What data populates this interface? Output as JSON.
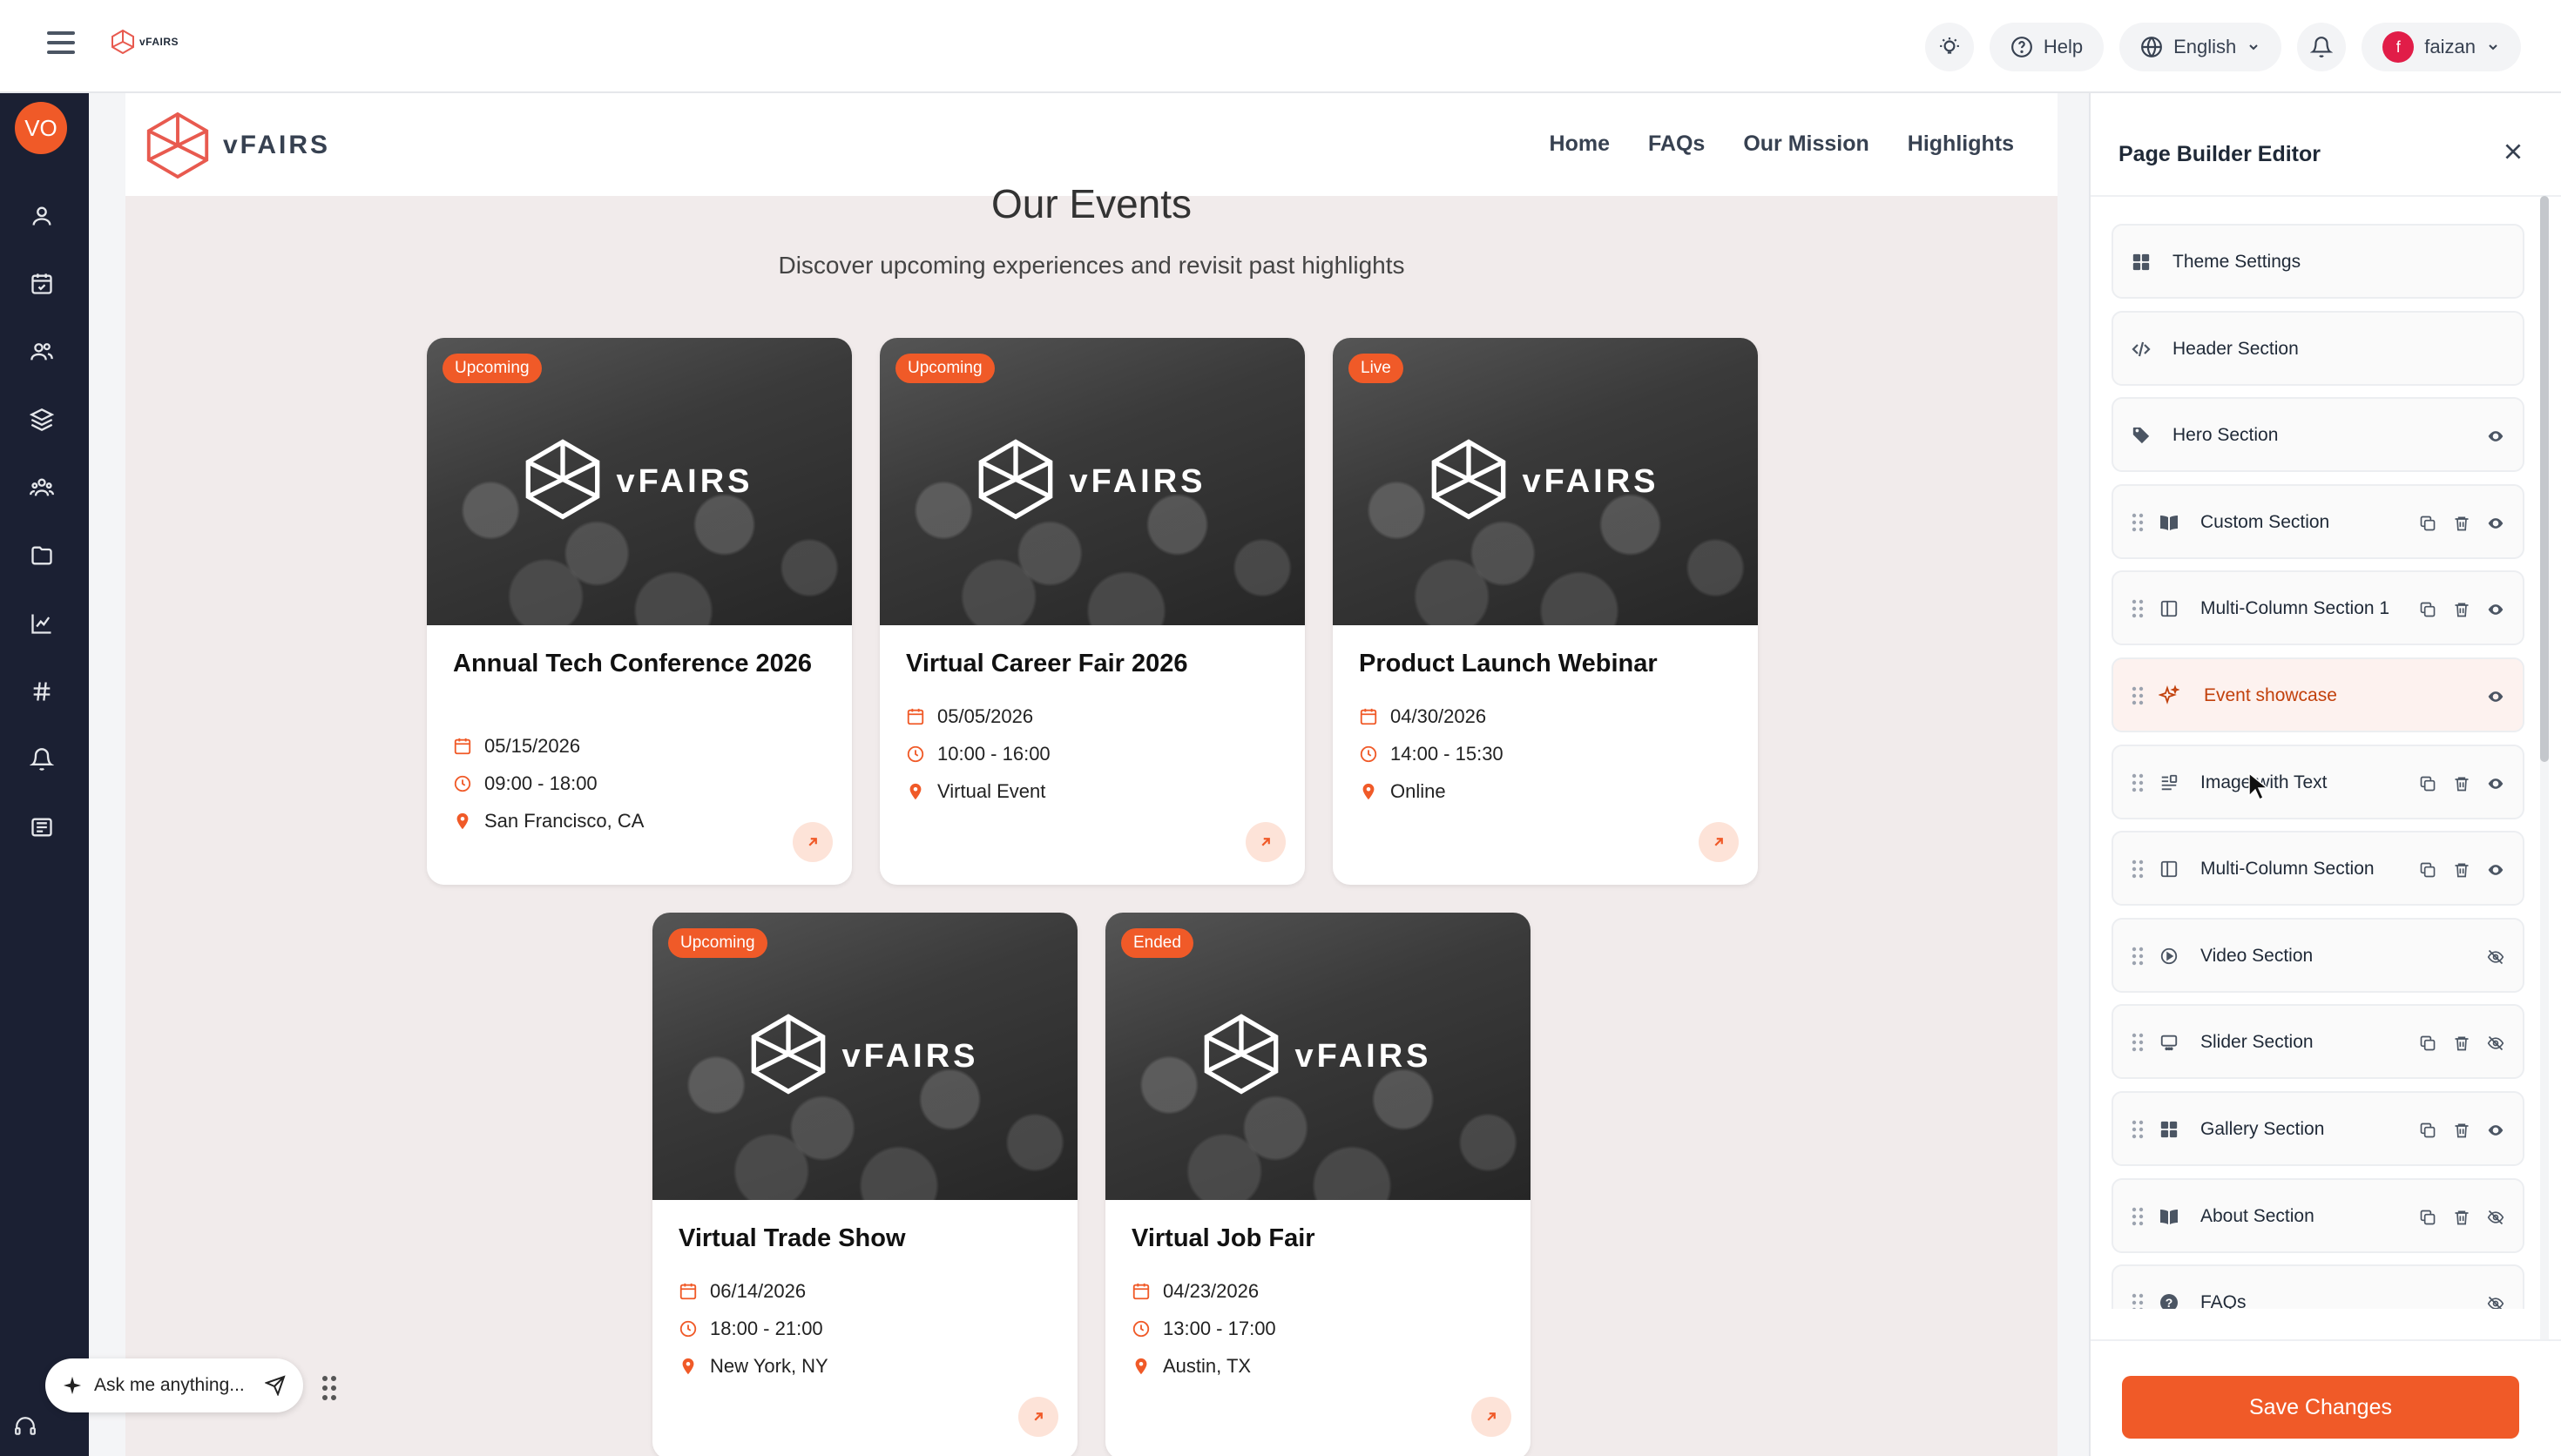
{
  "topbar": {
    "logo_text": "vFAIRS",
    "help_label": "Help",
    "language_label": "English",
    "user_initial": "f",
    "user_name": "faizan"
  },
  "sidebar": {
    "user_initials": "VO",
    "icons": [
      "user-icon",
      "calendar-check-icon",
      "users-icon",
      "layers-icon",
      "team-icon",
      "folder-icon",
      "analytics-icon",
      "hashtag-icon",
      "bell-icon",
      "news-icon",
      "headset-icon"
    ]
  },
  "site": {
    "brand": "vFAIRS",
    "nav": [
      "Home",
      "FAQs",
      "Our Mission",
      "Highlights"
    ],
    "title": "Our Events",
    "subtitle": "Discover upcoming experiences and revisit past highlights",
    "image_brand": "vFAIRS",
    "events": [
      {
        "badge": "Upcoming",
        "title": "Annual Tech Conference 2026",
        "date": "05/15/2026",
        "time": "09:00 - 18:00",
        "location": "San Francisco, CA"
      },
      {
        "badge": "Upcoming",
        "title": "Virtual Career Fair 2026",
        "date": "05/05/2026",
        "time": "10:00 - 16:00",
        "location": "Virtual Event"
      },
      {
        "badge": "Live",
        "title": "Product Launch Webinar",
        "date": "04/30/2026",
        "time": "14:00 - 15:30",
        "location": "Online"
      },
      {
        "badge": "Upcoming",
        "title": "Virtual Trade Show",
        "date": "06/14/2026",
        "time": "18:00 - 21:00",
        "location": "New York, NY"
      },
      {
        "badge": "Ended",
        "title": "Virtual Job Fair",
        "date": "04/23/2026",
        "time": "13:00 - 17:00",
        "location": "Austin, TX"
      }
    ]
  },
  "chat": {
    "placeholder": "Ask me anything..."
  },
  "panel": {
    "title": "Page Builder Editor",
    "save_label": "Save Changes",
    "sections": [
      {
        "label": "Theme Settings",
        "icon": "grid-icon",
        "draggable": false,
        "actions": []
      },
      {
        "label": "Header Section",
        "icon": "code-icon",
        "draggable": false,
        "actions": []
      },
      {
        "label": "Hero Section",
        "icon": "tag-icon",
        "draggable": false,
        "actions": [
          "visibility"
        ]
      },
      {
        "label": "Custom Section",
        "icon": "book-icon",
        "draggable": true,
        "actions": [
          "duplicate",
          "delete",
          "visibility"
        ]
      },
      {
        "label": "Multi-Column Section 1",
        "icon": "columns-icon",
        "draggable": true,
        "actions": [
          "duplicate",
          "delete",
          "visibility"
        ]
      },
      {
        "label": "Event showcase",
        "icon": "sparkle-icon",
        "draggable": true,
        "actions": [
          "visibility"
        ],
        "active": true
      },
      {
        "label": "Image with Text",
        "icon": "image-text-icon",
        "draggable": true,
        "actions": [
          "duplicate",
          "delete",
          "visibility"
        ]
      },
      {
        "label": "Multi-Column Section",
        "icon": "columns-icon",
        "draggable": true,
        "actions": [
          "duplicate",
          "delete",
          "visibility"
        ]
      },
      {
        "label": "Video Section",
        "icon": "play-icon",
        "draggable": true,
        "actions": [
          "hidden"
        ]
      },
      {
        "label": "Slider Section",
        "icon": "slider-icon",
        "draggable": true,
        "actions": [
          "duplicate",
          "delete",
          "hidden"
        ]
      },
      {
        "label": "Gallery Section",
        "icon": "grid-icon",
        "draggable": true,
        "actions": [
          "duplicate",
          "delete",
          "visibility"
        ]
      },
      {
        "label": "About Section",
        "icon": "book-icon",
        "draggable": true,
        "actions": [
          "duplicate",
          "delete",
          "hidden"
        ]
      },
      {
        "label": "FAQs",
        "icon": "question-icon",
        "draggable": true,
        "actions": [
          "hidden"
        ]
      }
    ]
  },
  "colors": {
    "accent": "#f05a28",
    "sidebar": "#1b2033",
    "site_bg": "#f1ebeb"
  }
}
